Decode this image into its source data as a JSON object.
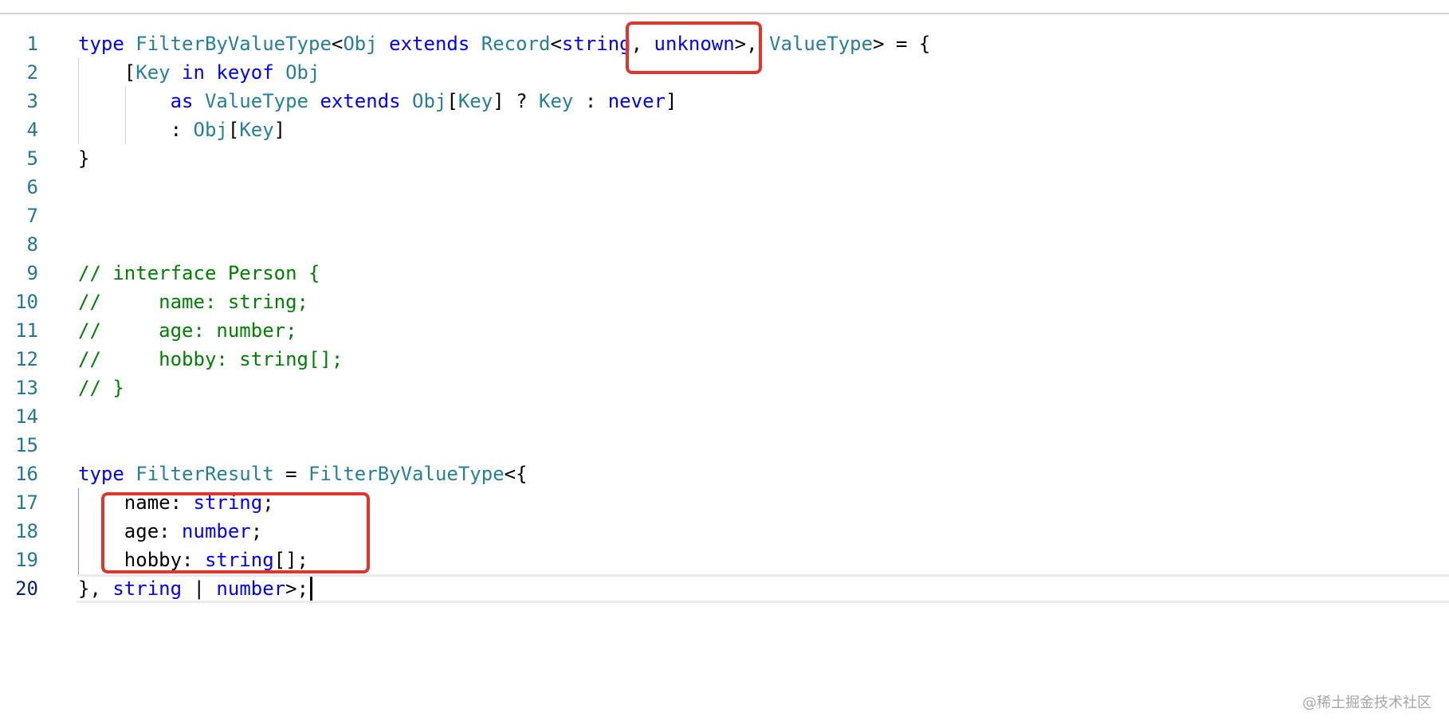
{
  "editor": {
    "lines": [
      {
        "n": "1",
        "segs": [
          [
            "k",
            "type "
          ],
          [
            "t",
            "FilterByValueType"
          ],
          [
            "p",
            "<"
          ],
          [
            "t",
            "Obj"
          ],
          [
            "k",
            " extends "
          ],
          [
            "t",
            "Record"
          ],
          [
            "p",
            "<"
          ],
          [
            "k",
            "string"
          ],
          [
            "p",
            ", "
          ],
          [
            "k",
            "unknown"
          ],
          [
            "p",
            ">, "
          ],
          [
            "t",
            "ValueType"
          ],
          [
            "p",
            "> = {"
          ]
        ]
      },
      {
        "n": "2",
        "segs": [
          [
            "p",
            "    ["
          ],
          [
            "t",
            "Key"
          ],
          [
            "k",
            " in "
          ],
          [
            "k",
            "keyof "
          ],
          [
            "t",
            "Obj"
          ]
        ]
      },
      {
        "n": "3",
        "segs": [
          [
            "p",
            "        "
          ],
          [
            "k",
            "as "
          ],
          [
            "t",
            "ValueType"
          ],
          [
            "k",
            " extends "
          ],
          [
            "t",
            "Obj"
          ],
          [
            "p",
            "["
          ],
          [
            "t",
            "Key"
          ],
          [
            "p",
            "] ? "
          ],
          [
            "t",
            "Key"
          ],
          [
            "p",
            " : "
          ],
          [
            "k",
            "never"
          ],
          [
            "p",
            "]"
          ]
        ]
      },
      {
        "n": "4",
        "segs": [
          [
            "p",
            "        : "
          ],
          [
            "t",
            "Obj"
          ],
          [
            "p",
            "["
          ],
          [
            "t",
            "Key"
          ],
          [
            "p",
            "]"
          ]
        ]
      },
      {
        "n": "5",
        "segs": [
          [
            "p",
            "}"
          ]
        ]
      },
      {
        "n": "6",
        "segs": []
      },
      {
        "n": "7",
        "segs": []
      },
      {
        "n": "8",
        "segs": []
      },
      {
        "n": "9",
        "segs": [
          [
            "c",
            "// interface Person {"
          ]
        ]
      },
      {
        "n": "10",
        "segs": [
          [
            "c",
            "//     name: string;"
          ]
        ]
      },
      {
        "n": "11",
        "segs": [
          [
            "c",
            "//     age: number;"
          ]
        ]
      },
      {
        "n": "12",
        "segs": [
          [
            "c",
            "//     hobby: string[];"
          ]
        ]
      },
      {
        "n": "13",
        "segs": [
          [
            "c",
            "// }"
          ]
        ]
      },
      {
        "n": "14",
        "segs": []
      },
      {
        "n": "15",
        "segs": []
      },
      {
        "n": "16",
        "segs": [
          [
            "k",
            "type "
          ],
          [
            "t",
            "FilterResult"
          ],
          [
            "p",
            " = "
          ],
          [
            "t",
            "FilterByValueType"
          ],
          [
            "p",
            "<{"
          ]
        ]
      },
      {
        "n": "17",
        "segs": [
          [
            "p",
            "    name: "
          ],
          [
            "k",
            "string"
          ],
          [
            "p",
            ";"
          ]
        ]
      },
      {
        "n": "18",
        "segs": [
          [
            "p",
            "    age: "
          ],
          [
            "k",
            "number"
          ],
          [
            "p",
            ";"
          ]
        ]
      },
      {
        "n": "19",
        "segs": [
          [
            "p",
            "    hobby: "
          ],
          [
            "k",
            "string"
          ],
          [
            "p",
            "[];"
          ]
        ]
      },
      {
        "n": "20",
        "segs": [
          [
            "p",
            "}, "
          ],
          [
            "k",
            "string"
          ],
          [
            "p",
            " | "
          ],
          [
            "k",
            "number"
          ],
          [
            "p",
            ">;"
          ]
        ]
      }
    ],
    "current_line": 20
  },
  "colors": {
    "keyword": "#0000ff",
    "type": "#267f99",
    "comment": "#008000",
    "line_number": "#237893",
    "highlight_box": "#e0352b"
  },
  "watermark": "@稀土掘金技术社区"
}
